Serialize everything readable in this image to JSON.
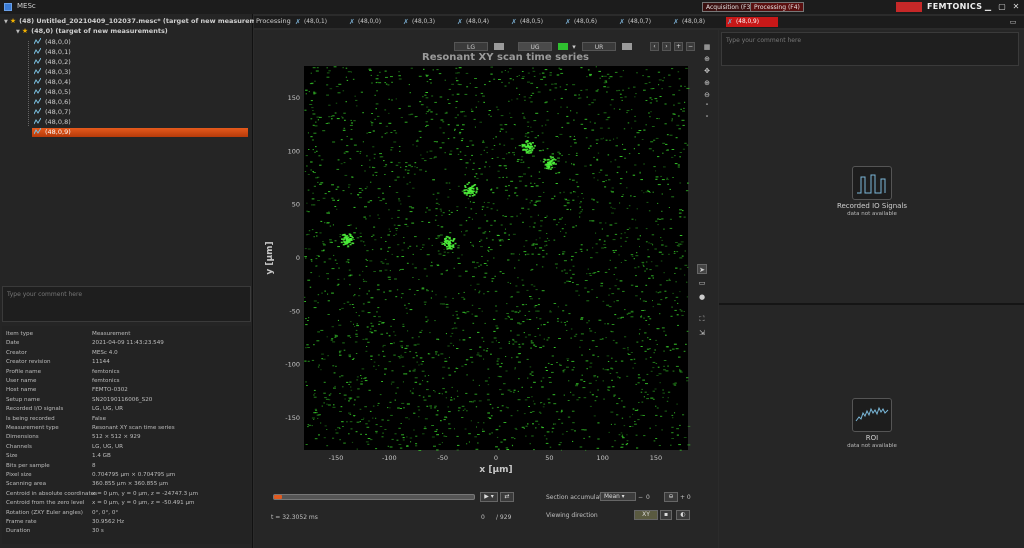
{
  "titlebar": {
    "app_title": "MESc",
    "mode_acquisition": "Acquisition (F3)",
    "mode_processing": "Processing (F4)",
    "logo": "FEMTONICS"
  },
  "tree": {
    "root": "(48) Untitled_20210409_102037.mesc* (target of new measurements)",
    "group": "(48,0)  (target of new measurements)",
    "items": [
      "(48,0,0)",
      "(48,0,1)",
      "(48,0,2)",
      "(48,0,3)",
      "(48,0,4)",
      "(48,0,5)",
      "(48,0,6)",
      "(48,0,7)",
      "(48,0,8)",
      "(48,0,9)"
    ],
    "selected_index": 9
  },
  "left_comment_placeholder": "Type your comment here",
  "properties": [
    {
      "k": "Item type",
      "v": "Measurement"
    },
    {
      "k": "Date",
      "v": "2021-04-09 11:43:23.549"
    },
    {
      "k": "Creator",
      "v": "MESc 4.0"
    },
    {
      "k": "Creator revision",
      "v": "11144"
    },
    {
      "k": "Profile name",
      "v": "femtonics"
    },
    {
      "k": "User name",
      "v": "femtonics"
    },
    {
      "k": "Host name",
      "v": "FEMTO-0302"
    },
    {
      "k": "Setup name",
      "v": "SN20190116006_S20"
    },
    {
      "k": "Recorded I/O signals",
      "v": "LG, UG, UR"
    },
    {
      "k": "Is being recorded",
      "v": "False"
    },
    {
      "k": "Measurement type",
      "v": "Resonant XY scan time series"
    },
    {
      "k": "Dimensions",
      "v": "512 × 512 × 929"
    },
    {
      "k": "Channels",
      "v": "LG, UG, UR"
    },
    {
      "k": "Size",
      "v": "1.4 GB"
    },
    {
      "k": "Bits per sample",
      "v": "8"
    },
    {
      "k": "Pixel size",
      "v": "0.704795 µm × 0.704795 µm"
    },
    {
      "k": "Scanning area",
      "v": "360.855 µm × 360.855 µm"
    },
    {
      "k": "Centroid in absolute coordinates",
      "v": "x = 0 µm, y = 0 µm, z = -24747.3 µm"
    },
    {
      "k": "Centroid from the zero level",
      "v": "x = 0 µm, y = 0 µm, z = -50.491 µm"
    },
    {
      "k": "Rotation (ZXY Euler angles)",
      "v": "0°, 0°, 0°"
    },
    {
      "k": "Frame rate",
      "v": "30.9562 Hz"
    },
    {
      "k": "Duration",
      "v": "30 s"
    }
  ],
  "tabs": {
    "label": "Processing",
    "items": [
      "(48,0,1)",
      "(48,0,0)",
      "(48,0,3)",
      "(48,0,4)",
      "(48,0,5)",
      "(48,0,6)",
      "(48,0,7)",
      "(48,0,8)",
      "(48,0,9)"
    ],
    "active_index": 8
  },
  "channels": [
    "LG",
    "UG",
    "UR"
  ],
  "colors": {
    "accent": "#e05a20",
    "active_tab": "#c81818",
    "signal": "#39d62c"
  },
  "chart_data": {
    "type": "heatmap",
    "title": "Resonant XY scan time series",
    "xlabel": "x [µm]",
    "ylabel": "y [µm]",
    "xlim": [
      -180,
      180
    ],
    "ylim": [
      -180,
      180
    ],
    "xticks": [
      -150,
      -100,
      -50,
      0,
      50,
      100,
      150
    ],
    "yticks": [
      150,
      100,
      50,
      0,
      -50,
      -100,
      -150
    ],
    "bright_spots": [
      {
        "x": 50,
        "y": 90
      },
      {
        "x": -45,
        "y": 15
      },
      {
        "x": -140,
        "y": 18
      },
      {
        "x": -25,
        "y": 65
      },
      {
        "x": 30,
        "y": 105
      }
    ]
  },
  "controls": {
    "time_label": "t = 32.3052 ms",
    "frame_value": "0",
    "frame_total": "/ 929",
    "section_accumulation_label": "Section accumulation",
    "accumulation_mode": "Mean",
    "minus_value": "0",
    "plus_value": "+ 0",
    "viewing_direction_label": "Viewing direction",
    "view_xy": "XY"
  },
  "right_comment_placeholder": "Type your comment here",
  "widgets": {
    "io_title": "Recorded IO Signals",
    "io_sub": "data not available",
    "roi_title": "ROI",
    "roi_sub": "data not available"
  }
}
